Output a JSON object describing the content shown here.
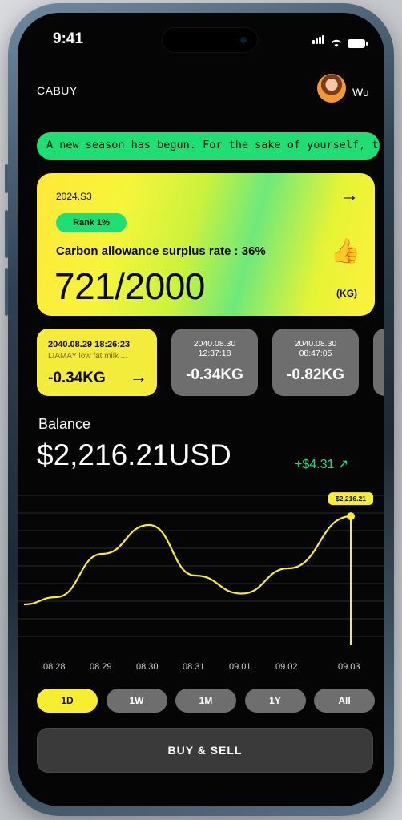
{
  "status": {
    "time": "9:41"
  },
  "header": {
    "app_title": "CABUY",
    "user_name": "Wu"
  },
  "ticker": {
    "text": "A new season has begun. For the sake of yourself, th"
  },
  "season_card": {
    "season": "2024.S3",
    "rank": "Rank 1%",
    "surplus_text": "Carbon allowance surplus rate : 36%",
    "carbon_value": "721/2000",
    "unit": "(KG)",
    "arrow": "→",
    "icon": "thumbs-up-icon"
  },
  "transactions": [
    {
      "date": "2040.08.29 18:26:23",
      "note": "LIAMAY low fat milk ...",
      "amount": "-0.34KG",
      "arrow": "→"
    },
    {
      "date": "2040.08.30",
      "time": "12:37:18",
      "amount": "-0.34KG"
    },
    {
      "date": "2040.08.30",
      "time": "08:47:05",
      "amount": "-0.82KG"
    }
  ],
  "balance": {
    "label": "Balance",
    "value": "$2,216.21USD",
    "change": "+$4.31 ↗",
    "tooltip": "$2,216.21"
  },
  "chart_data": {
    "type": "line",
    "x": [
      "08.28",
      "08.29",
      "08.30",
      "08.31",
      "09.01",
      "09.02",
      "09.03"
    ],
    "series": [
      {
        "values": [
          2205,
          2211,
          2215,
          2208,
          2205.5,
          2209,
          2216.21
        ]
      }
    ],
    "line_color": "#f6ee2e",
    "grid": true
  },
  "periods": [
    {
      "label": "1D",
      "active": true
    },
    {
      "label": "1W",
      "active": false
    },
    {
      "label": "1M",
      "active": false
    },
    {
      "label": "1Y",
      "active": false
    },
    {
      "label": "All",
      "active": false
    }
  ],
  "actions": {
    "buy_sell": "BUY & SELL"
  },
  "colors": {
    "accent_green": "#1ddf73",
    "accent_yellow": "#f6ee2e"
  }
}
